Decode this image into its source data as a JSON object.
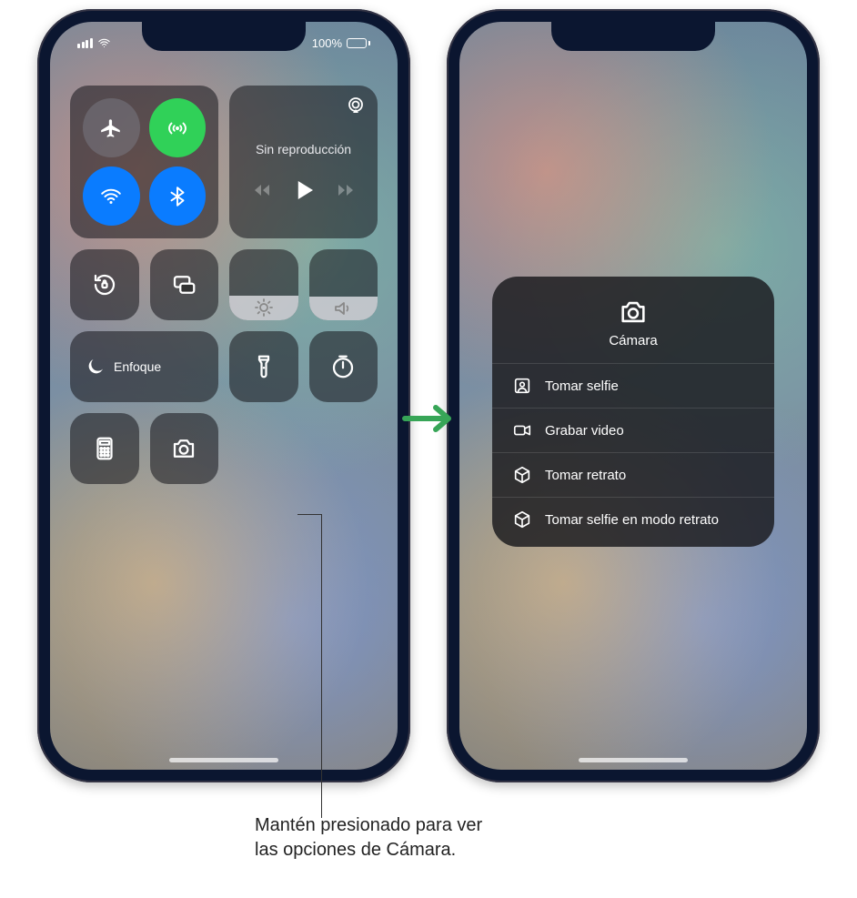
{
  "status": {
    "battery_pct": "100%"
  },
  "media": {
    "now_playing_label": "Sin reproducción"
  },
  "focus": {
    "label": "Enfoque"
  },
  "camera_menu": {
    "title": "Cámara",
    "items": [
      {
        "label": "Tomar selfie"
      },
      {
        "label": "Grabar video"
      },
      {
        "label": "Tomar retrato"
      },
      {
        "label": "Tomar selfie en modo retrato"
      }
    ]
  },
  "callout": {
    "line1": "Mantén presionado para ver",
    "line2": "las opciones de Cámara."
  },
  "icons": {
    "airplane": "airplane-icon",
    "cellular": "cellular-icon",
    "wifi": "wifi-icon",
    "bluetooth": "bluetooth-icon",
    "airplay": "airplay-icon",
    "rotation_lock": "rotation-lock-icon",
    "screen_mirroring": "screen-mirroring-icon",
    "moon": "moon-icon",
    "brightness": "brightness-icon",
    "volume": "volume-icon",
    "flashlight": "flashlight-icon",
    "timer": "timer-icon",
    "calculator": "calculator-icon",
    "camera": "camera-icon",
    "selfie": "selfie-icon",
    "video": "video-icon",
    "cube": "cube-icon"
  },
  "colors": {
    "accent_green": "#30d158",
    "accent_blue": "#0a7cff",
    "tile_bg": "rgba(20,20,25,.55)"
  }
}
